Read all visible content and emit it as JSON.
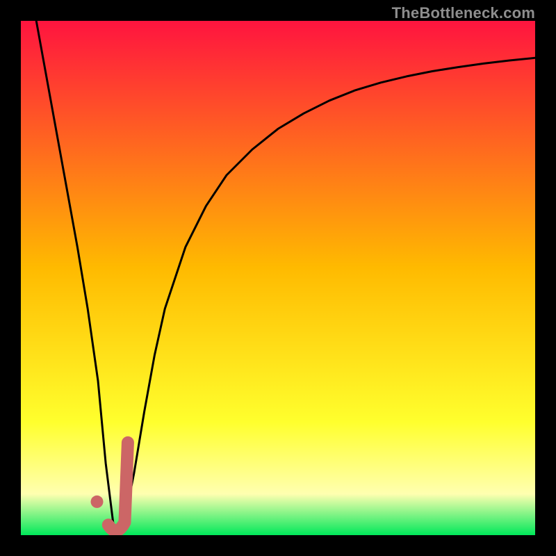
{
  "watermark": "TheBottleneck.com",
  "colors": {
    "gradient_top": "#ff143f",
    "gradient_mid": "#ffba00",
    "gradient_low": "#ffff2d",
    "gradient_pale": "#ffffb0",
    "gradient_bottom": "#00e85a",
    "frame": "#000000",
    "curve": "#000000",
    "marker": "#cc6666"
  },
  "chart_data": {
    "type": "line",
    "title": "",
    "xlabel": "",
    "ylabel": "",
    "xlim": [
      0,
      100
    ],
    "ylim": [
      0,
      100
    ],
    "grid": false,
    "series": [
      {
        "name": "bottleneck-curve",
        "x": [
          3,
          5,
          7,
          9,
          11,
          13,
          15,
          16.5,
          18,
          19,
          20,
          22,
          24,
          26,
          28,
          32,
          36,
          40,
          45,
          50,
          55,
          60,
          65,
          70,
          75,
          80,
          85,
          90,
          95,
          100
        ],
        "values": [
          100,
          89,
          78,
          67,
          56,
          44,
          30,
          14,
          2,
          0,
          2,
          12,
          24,
          35,
          44,
          56,
          64,
          70,
          75,
          79,
          82,
          84.5,
          86.5,
          88,
          89.2,
          90.2,
          91,
          91.7,
          92.3,
          92.8
        ]
      }
    ],
    "annotations": [
      {
        "name": "marker-j",
        "x_range": [
          17,
          21
        ],
        "shape": "J",
        "color": "#cc6666"
      },
      {
        "name": "marker-dot",
        "x": 15.5,
        "y": 6,
        "shape": "dot",
        "color": "#cc6666"
      }
    ]
  }
}
